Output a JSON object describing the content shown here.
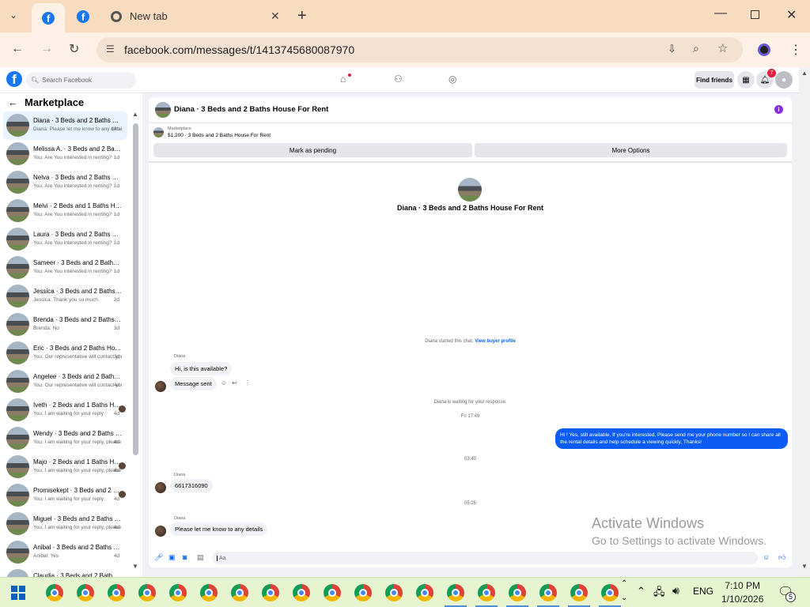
{
  "browser": {
    "tabs": [
      {
        "kind": "facebook"
      },
      {
        "kind": "facebook"
      },
      {
        "label": "New tab"
      }
    ],
    "url": "facebook.com/messages/t/1413745680087970"
  },
  "fb_header": {
    "search_placeholder": "Search Facebook",
    "find_friends": "Find friends",
    "notification_count": "7"
  },
  "sidebar": {
    "title": "Marketplace",
    "conversations": [
      {
        "title": "Diana · 3 Beds and 2 Baths House For Rent",
        "preview": "Diana: Please let me know to any details",
        "time": "13h",
        "selected": true
      },
      {
        "title": "Melissa A. · 3 Beds and 2 Baths House For Rent",
        "preview": "You: Are You interested in renting?",
        "time": "1d"
      },
      {
        "title": "Nelva · 3 Beds and 2 Baths House For Rent",
        "preview": "You: Are You interested in renting?",
        "time": "1d"
      },
      {
        "title": "Melvi · 2 Beds and 1 Baths House For Rent",
        "preview": "You: Are You interested in renting?",
        "time": "1d"
      },
      {
        "title": "Laura · 3 Beds and 2 Baths House For Rent",
        "preview": "You: Are You interested in renting?",
        "time": "1d"
      },
      {
        "title": "Sameer · 3 Beds and 2 Baths House For Rent",
        "preview": "You: Are You interested in renting?",
        "time": "1d"
      },
      {
        "title": "Jessica · 3 Beds and 2 Baths House For Rent",
        "preview": "Jessica: Thank you so much.",
        "time": "2d"
      },
      {
        "title": "Brenda · 3 Beds and 2 Baths House For Rent",
        "preview": "Brenda: No",
        "time": "3d"
      },
      {
        "title": "Eric · 3 Beds and 2 Baths House For Rent",
        "preview": "You: Our representative will contact you",
        "time": "3d"
      },
      {
        "title": "Angelee · 3 Beds and 2 Baths House For Rent",
        "preview": "You: Our representative will contact you",
        "time": "4d"
      },
      {
        "title": "Iveth · 2 Beds and 1 Baths House For Rent",
        "preview": "You: I am waiting for your reply",
        "time": "4d",
        "seen": true
      },
      {
        "title": "Wendy · 3 Beds and 2 Baths House For Rent",
        "preview": "You: I am waiting for your reply, please",
        "time": "4d"
      },
      {
        "title": "Majo · 2 Beds and 1 Baths House For Rent",
        "preview": "You: I am waiting for your reply, please",
        "time": "4d",
        "seen": true
      },
      {
        "title": "Promisekept · 3 Beds and 2 Baths House For Rent",
        "preview": "You: I am waiting for your reply",
        "time": "4d",
        "seen": true
      },
      {
        "title": "Miguel · 3 Beds and 2 Baths House For Rent",
        "preview": "You: I am waiting for your reply, please",
        "time": "4d"
      },
      {
        "title": "Anibal · 3 Beds and 2 Baths House For Rent",
        "preview": "Anibal: Yes",
        "time": "4d"
      },
      {
        "title": "Claudia · 3 Beds and 2 Bath",
        "preview": "",
        "time": ""
      }
    ]
  },
  "chat": {
    "header_title": "Diana · 3 Beds and 2 Baths House For Rent",
    "listing_label": "Marketplace",
    "listing_detail": "$1,200 · 3 Beds and 2 Baths House For Rent",
    "btn_pending": "Mark as pending",
    "btn_more": "More Options",
    "intro_title": "Diana · 3 Beds and 2 Baths House For Rent",
    "started_note": "Diana started this chat.",
    "view_profile": "View buyer profile",
    "sender_name": "Diana",
    "msg1": "Hi, is this available?",
    "msg2": "Message sent",
    "waiting_note": "Diana is waiting for your response.",
    "time1": "Fri 17:49",
    "outgoing": "Hi ! Yes, still available. If you're interested, Please send me your phone number so I can share all the rental details and help schedule a viewing quickly, Thanks!",
    "time2": "03:40",
    "msg3": "6617316090",
    "time3": "05:25",
    "msg4": "Please let me know to any details",
    "input_value": "Aa"
  },
  "watermark": {
    "line1": "Activate Windows",
    "line2": "Go to Settings to activate Windows."
  },
  "taskbar": {
    "language": "ENG",
    "time": "7:10 PM",
    "date": "1/10/2026",
    "notif_count": "5"
  }
}
